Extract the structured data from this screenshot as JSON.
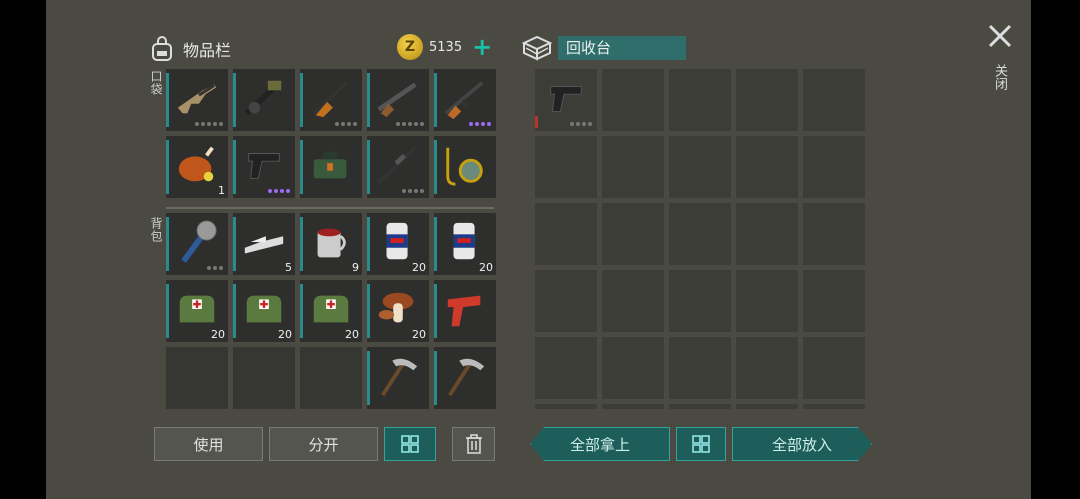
{
  "inventory": {
    "title": "物品栏",
    "coins": "5135",
    "pocket_label": "口袋",
    "backpack_label": "背包",
    "pocket_slots": [
      {
        "icon": "assault-rifle-icon",
        "dots": "....."
      },
      {
        "icon": "grenade-launcher-icon"
      },
      {
        "icon": "rifle-icon",
        "dots": "...."
      },
      {
        "icon": "shotgun-icon",
        "dots": "....."
      },
      {
        "icon": "ak-rifle-icon",
        "dots": "....",
        "rare": true
      },
      {
        "icon": "roast-chicken-icon",
        "qty": "1"
      },
      {
        "icon": "pistol-icon",
        "dots": "....",
        "rare": true
      },
      {
        "icon": "ammo-box-icon"
      },
      {
        "icon": "sniper-rifle-icon",
        "dots": "...."
      },
      {
        "icon": "magnifier-tool-icon"
      }
    ],
    "backpack_slots": [
      {
        "icon": "spiked-club-icon",
        "dots": "..."
      },
      {
        "icon": "metal-ingots-icon",
        "qty": "5"
      },
      {
        "icon": "mug-icon",
        "qty": "9"
      },
      {
        "icon": "soda-can-icon",
        "qty": "20"
      },
      {
        "icon": "soda-can-icon",
        "qty": "20"
      },
      {
        "icon": "medkit-bag-icon",
        "qty": "20"
      },
      {
        "icon": "medkit-bag-icon",
        "qty": "20"
      },
      {
        "icon": "medkit-bag-icon",
        "qty": "20"
      },
      {
        "icon": "mushroom-icon",
        "qty": "20"
      },
      {
        "icon": "flare-gun-icon"
      },
      {
        "icon": "empty"
      },
      {
        "icon": "empty"
      },
      {
        "icon": "empty"
      },
      {
        "icon": "pickaxe-icon"
      },
      {
        "icon": "pickaxe-icon"
      }
    ]
  },
  "recycler": {
    "title": "回收台",
    "slots": [
      {
        "icon": "pistol-icon",
        "dots": "...."
      }
    ]
  },
  "buttons": {
    "use": "使用",
    "split": "分开",
    "take_all": "全部拿上",
    "put_all": "全部放入"
  },
  "close_label": "关闭",
  "colors": {
    "accent": "#19c0a8",
    "panel": "#4a4a42",
    "slot": "#363632"
  }
}
